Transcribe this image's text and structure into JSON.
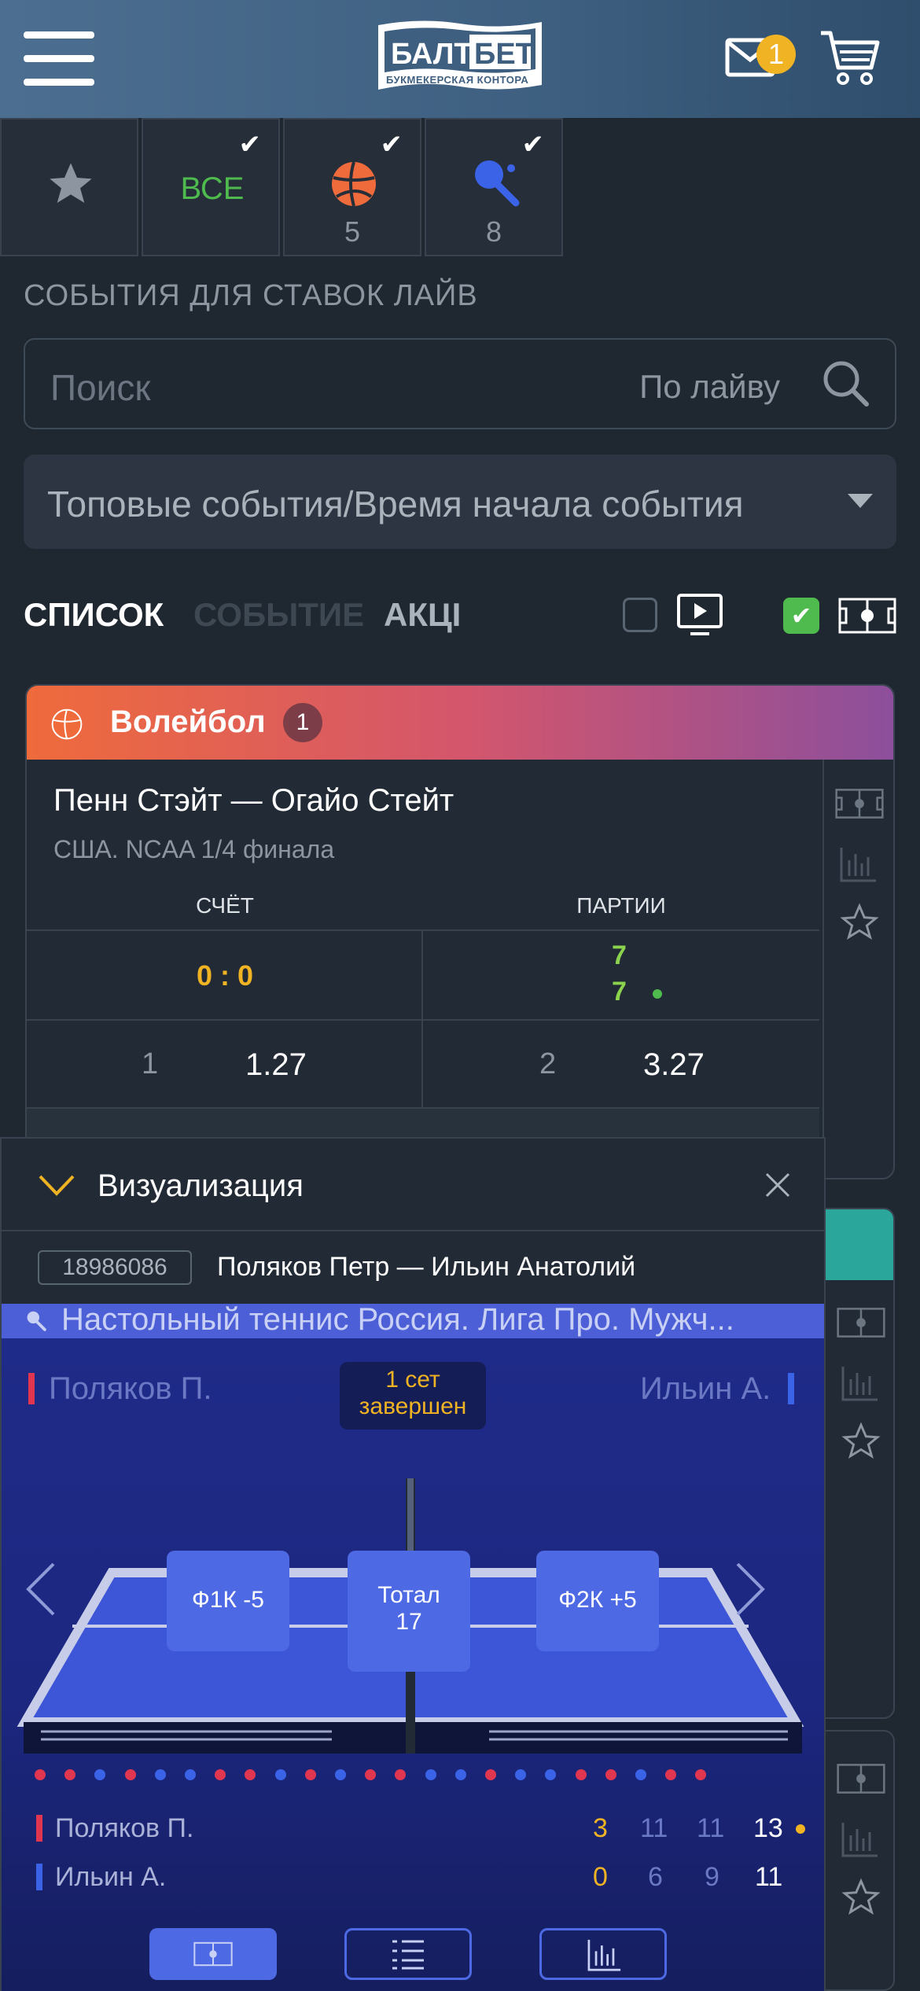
{
  "header": {
    "logo_top": "БАЛТ",
    "logo_bet": "БЕТ",
    "logo_sub": "БУКМЕКЕРСКАЯ КОНТОРА",
    "mail_badge": "1",
    "colors": {
      "bg": "#3e5f80",
      "badge": "#f0b323"
    }
  },
  "sport_tabs": [
    {
      "icon": "star-icon"
    },
    {
      "label": "ВСЕ",
      "checked": true
    },
    {
      "icon": "volleyball-icon",
      "count": "5",
      "checked": true
    },
    {
      "icon": "table-tennis-icon",
      "count": "8",
      "checked": true
    }
  ],
  "section_title": "СОБЫТИЯ ДЛЯ СТАВОК ЛАЙВ",
  "search": {
    "placeholder": "Поиск",
    "mode": "По лайву"
  },
  "sort": {
    "selected": "Топовые события/Время начала события"
  },
  "view_tabs": {
    "list": "СПИСОК",
    "event": "СОБЫТИЕ",
    "promo": "АКЦІ"
  },
  "filters": {
    "video_checked": false,
    "visual_checked": true
  },
  "sport_section": {
    "name": "Волейбол",
    "count": "1"
  },
  "event": {
    "title": "Пенн Стэйт — Огайо Стейт",
    "league": "США. NCAA 1/4 финала",
    "score_header": "СЧЁТ",
    "sets_header": "ПАРТИИ",
    "score": "0 : 0",
    "sets_home": "7",
    "sets_away": "7",
    "odds": [
      {
        "label": "1",
        "value": "1.27"
      },
      {
        "label": "2",
        "value": "3.27"
      }
    ]
  },
  "visualization": {
    "title": "Визуализация",
    "event_id": "18986086",
    "match": "Поляков Петр — Ильин Анатолий",
    "league": "Настольный теннис Россия. Лига Про. Мужч...",
    "player1": "Поляков П.",
    "player2": "Ильин А.",
    "status_line1": "1 сет",
    "status_line2": "завершен",
    "bets": [
      "Ф1К -5",
      "Тотал",
      "17",
      "Ф2К +5"
    ],
    "dots": [
      "r",
      "r",
      "b",
      "r",
      "b",
      "b",
      "r",
      "r",
      "b",
      "r",
      "b",
      "r",
      "r",
      "b",
      "b",
      "r",
      "b",
      "b",
      "r",
      "r",
      "b",
      "r",
      "r"
    ],
    "scores": [
      {
        "name": "Поляков П.",
        "values": [
          "3",
          "11",
          "11",
          "13"
        ]
      },
      {
        "name": "Ильин А.",
        "values": [
          "0",
          "6",
          "9",
          "11"
        ]
      }
    ],
    "colors": {
      "field": "#1f2b88",
      "p1": "#e0364f",
      "p2": "#3a63e8",
      "accent": "#f0b323"
    }
  }
}
